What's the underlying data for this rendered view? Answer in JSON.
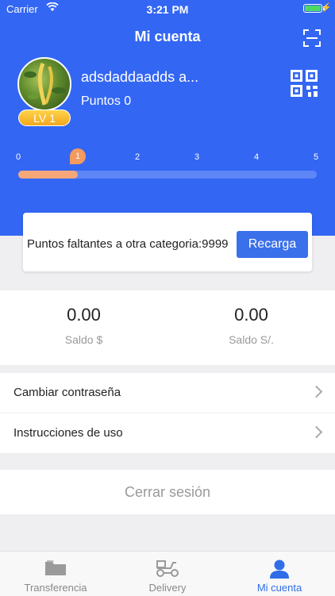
{
  "status_bar": {
    "carrier": "Carrier",
    "time": "3:21 PM"
  },
  "header": {
    "title": "Mi cuenta"
  },
  "profile": {
    "username": "adsdaddaadds a...",
    "points_label": "Puntos 0",
    "level_badge": "LV 1"
  },
  "levels": {
    "labels": [
      "0",
      "1",
      "2",
      "3",
      "4",
      "5"
    ],
    "current_index": 1,
    "progress_fraction": 0.2
  },
  "promo_card": {
    "text": "Puntos faltantes a otra categoria:9999",
    "button_label": "Recarga"
  },
  "balances": [
    {
      "amount": "0.00",
      "label": "Saldo $"
    },
    {
      "amount": "0.00",
      "label": "Saldo S/."
    }
  ],
  "menu": [
    {
      "label": "Cambiar contraseña"
    },
    {
      "label": "Instrucciones de uso"
    }
  ],
  "logout_label": "Cerrar sesión",
  "tabs": [
    {
      "label": "Transferencia",
      "icon": "folder-icon",
      "active": false
    },
    {
      "label": "Delivery",
      "icon": "scooter-icon",
      "active": false
    },
    {
      "label": "Mi cuenta",
      "icon": "person-icon",
      "active": true
    }
  ],
  "colors": {
    "primary": "#3366f3",
    "accent_orange": "#f39a5e",
    "badge_gold": "#f2a81d",
    "button_blue": "#3a70ea",
    "active_tab": "#2f6ee8"
  }
}
